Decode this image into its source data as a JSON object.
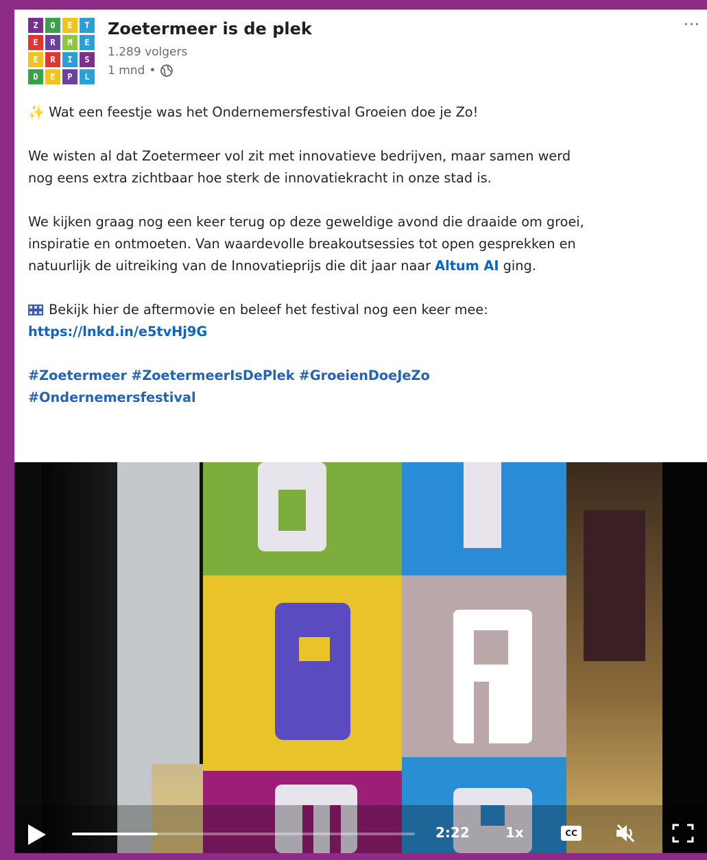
{
  "post": {
    "author": {
      "name": "Zoetermeer is de plek",
      "followers": "1.289 volgers",
      "time": "1 mnd",
      "separator": "•",
      "visibility_icon": "globe-icon",
      "logo_letters": [
        "Z",
        "O",
        "E",
        "T",
        "E",
        "R",
        "M",
        "E",
        "E",
        "R",
        "I",
        "S",
        "D",
        "E",
        "P",
        "L"
      ],
      "logo_colors": [
        "#7b2f8e",
        "#3aa14b",
        "#f0c419",
        "#2b9fd8",
        "#e3342f",
        "#6c3fa0",
        "#8dc63f",
        "#2b9fd8",
        "#f0c419",
        "#e3342f",
        "#2b9fd8",
        "#7b2f8e",
        "#3aa14b",
        "#f0c419",
        "#6c3fa0",
        "#2b9fd8"
      ]
    },
    "more_label": "···",
    "lines": {
      "intro_emoji": "✨",
      "intro": "Wat een feestje was het Ondernemersfestival Groeien doe je Zo!",
      "para1_line1": "We wisten al dat Zoetermeer vol zit met innovatieve bedrijven, maar samen werd",
      "para1_line2": "nog eens extra zichtbaar hoe sterk de innovatiekracht in onze stad is.",
      "para2_line1": "We kijken graag nog een keer terug op deze geweldige avond die draaide om groei,",
      "para2_line2": "inspiratie en ontmoeten. Van waardevolle breakoutsessies tot open gesprekken en",
      "para2_line3_pre": "natuurlijk de uitreiking van de Innovatieprijs die dit jaar naar ",
      "mention": "Altum AI",
      "para2_line3_post": " ging.",
      "film_emoji": "film-frames-icon",
      "para3_line1": "Bekijk hier de aftermovie en beleef het festival nog een keer mee:",
      "link": "https://lnkd.in/e5tvHj9G",
      "hashtags_line1": [
        "#Zoetermeer",
        "#ZoetermeerIsDePlek",
        "#GroeienDoeJeZo"
      ],
      "hashtags_line2": [
        "#Ondernemersfestival"
      ]
    },
    "video": {
      "time": "2:22",
      "speed": "1x",
      "cc_label": "CC",
      "progress": 0.25,
      "poster_letters": [
        "E",
        "T",
        "E",
        "R",
        "M",
        "E"
      ]
    }
  }
}
